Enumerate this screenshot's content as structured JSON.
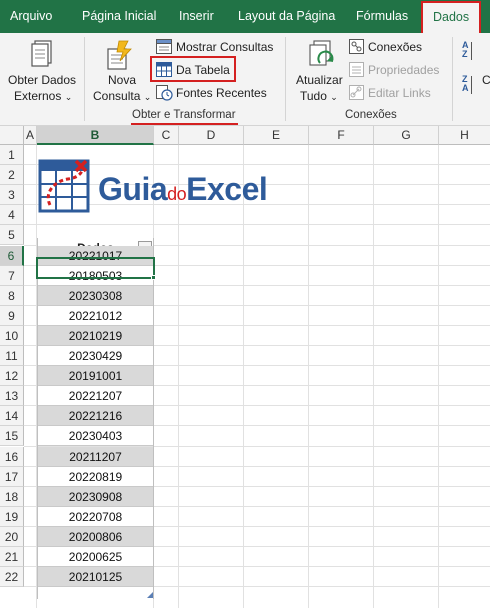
{
  "tabs": [
    {
      "label": "Arquivo",
      "active": false
    },
    {
      "label": "Página Inicial",
      "active": false
    },
    {
      "label": "Inserir",
      "active": false
    },
    {
      "label": "Layout da Página",
      "active": false
    },
    {
      "label": "Fórmulas",
      "active": false
    },
    {
      "label": "Dados",
      "active": true
    }
  ],
  "ribbon": {
    "obter_dados": {
      "line1": "Obter Dados",
      "line2": "Externos",
      "icon": "database-icon"
    },
    "nova_consulta": {
      "line1": "Nova",
      "line2": "Consulta",
      "icon": "new-query-icon"
    },
    "mostrar_consultas": {
      "label": "Mostrar Consultas",
      "icon": "show-queries-icon"
    },
    "da_tabela": {
      "label": "Da Tabela",
      "icon": "table-icon"
    },
    "fontes_recentes": {
      "label": "Fontes Recentes",
      "icon": "recent-sources-icon"
    },
    "group_obter": "Obter e Transformar",
    "atualizar": {
      "line1": "Atualizar",
      "line2": "Tudo",
      "icon": "refresh-all-icon"
    },
    "conexoes": {
      "label": "Conexões",
      "icon": "connections-icon"
    },
    "propriedades": {
      "label": "Propriedades",
      "icon": "properties-icon"
    },
    "editar_links": {
      "label": "Editar Links",
      "icon": "edit-links-icon"
    },
    "group_conexoes": "Conexões",
    "sort_az": {
      "top": "A",
      "bottom": "Z",
      "icon": "sort-ascending-icon"
    },
    "sort_za": {
      "top": "Z",
      "bottom": "A",
      "icon": "sort-descending-icon"
    },
    "cut_letter": "C"
  },
  "columns": [
    "A",
    "B",
    "C",
    "D",
    "E",
    "F",
    "G",
    "H"
  ],
  "rows": [
    "1",
    "2",
    "3",
    "4",
    "5",
    "6",
    "7",
    "8",
    "9",
    "10",
    "11",
    "12",
    "13",
    "14",
    "15",
    "16",
    "17",
    "18",
    "19",
    "20",
    "21",
    "22"
  ],
  "logo": {
    "part1": "Guia",
    "part2": "do",
    "part3": "Excel"
  },
  "table": {
    "header": "Dados",
    "values": [
      "20221017",
      "20180503",
      "20230308",
      "20221012",
      "20210219",
      "20230429",
      "20191001",
      "20221207",
      "20221216",
      "20230403",
      "20211207",
      "20220819",
      "20230908",
      "20220708",
      "20200806",
      "20200625",
      "20210125"
    ]
  },
  "colors": {
    "excel_green": "#217346",
    "highlight_red": "#d42020",
    "logo_blue": "#2e5b9a",
    "band_gray": "#d9d9d9"
  }
}
